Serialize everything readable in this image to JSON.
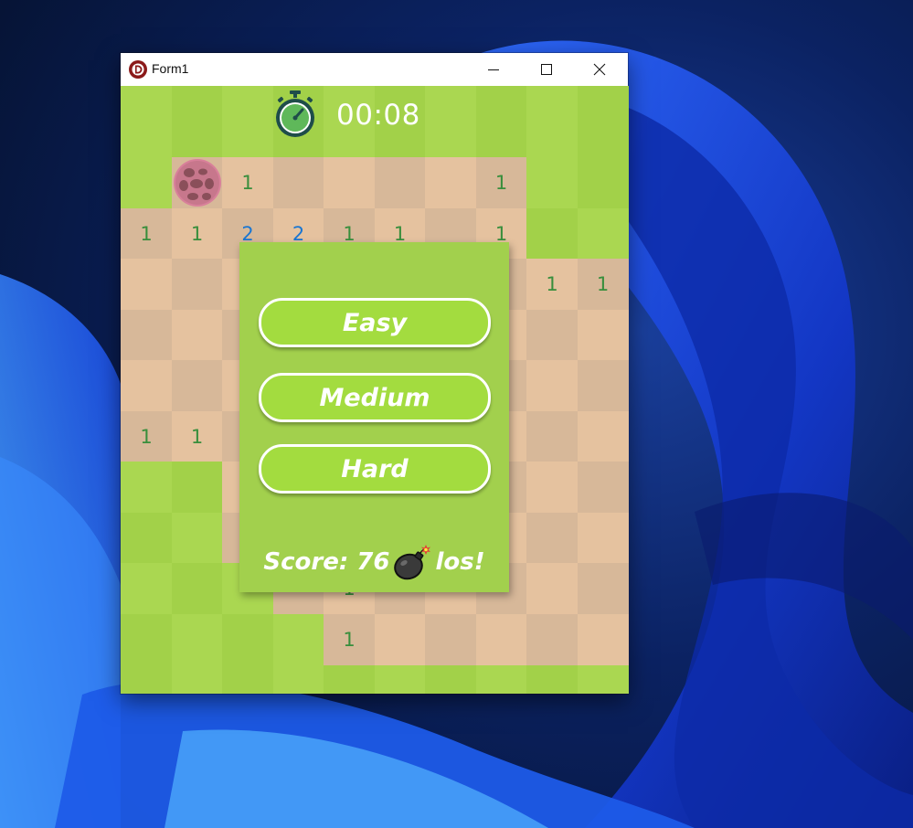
{
  "window": {
    "title": "Form1"
  },
  "timer": {
    "value": "00:08"
  },
  "board": {
    "rows": [
      [
        "G",
        "M",
        "1",
        "",
        "",
        "",
        "",
        "1",
        "G",
        "G"
      ],
      [
        "1",
        "1",
        "2",
        "2",
        "1",
        "1",
        "",
        "1",
        "G",
        "G"
      ],
      [
        "",
        "",
        "",
        "",
        "",
        "",
        "",
        "",
        "1",
        "1"
      ],
      [
        "",
        "",
        "",
        "",
        "",
        "",
        "",
        "",
        "",
        ""
      ],
      [
        "",
        "",
        "",
        "",
        "",
        "",
        "",
        "",
        "",
        ""
      ],
      [
        "1",
        "1",
        "",
        "",
        "",
        "",
        "",
        "",
        "",
        ""
      ],
      [
        "G",
        "G",
        "",
        "",
        "",
        "",
        "",
        "",
        "",
        ""
      ],
      [
        "G",
        "G",
        "",
        "",
        "",
        "",
        "",
        "",
        "",
        ""
      ],
      [
        "G",
        "G",
        "G",
        "",
        "1",
        "",
        "",
        "",
        "",
        ""
      ],
      [
        "G",
        "G",
        "G",
        "G",
        "1",
        "",
        "",
        "",
        "",
        ""
      ]
    ],
    "legend": {
      "G": "unrevealed",
      "M": "mine"
    }
  },
  "dialog": {
    "buttons": [
      "Easy",
      "Medium",
      "Hard"
    ],
    "score_prefix": "Score: 76",
    "score_suffix": "los!"
  },
  "colors": {
    "grass_light": "#aad751",
    "grass_dark": "#a2d149",
    "dirt_light": "#e5c29f",
    "dirt_dark": "#d7b899",
    "number_green": "#388e3c",
    "number_blue": "#1976d2"
  }
}
